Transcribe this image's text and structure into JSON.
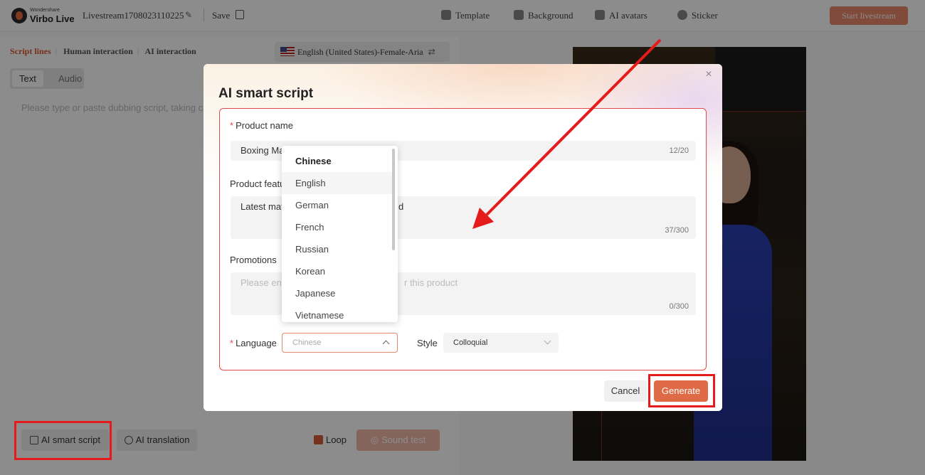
{
  "app": {
    "logo_small": "Wondershare",
    "logo_big": "Virbo Live",
    "project_name": "Livestream1708023110225",
    "save_label": "Save",
    "nav": [
      "Template",
      "Background",
      "AI avatars",
      "Sticker"
    ],
    "start_label": "Start livestream"
  },
  "left_panel": {
    "tabs": [
      "Script lines",
      "Human interaction",
      "AI interaction"
    ],
    "voice": "English (United States)-Female-Aria",
    "mode_tabs": [
      "Text",
      "Audio"
    ],
    "script_placeholder": "Please type or paste dubbing script, taking ca",
    "ai_smart_script": "AI smart script",
    "ai_translation": "AI translation",
    "loop": "Loop",
    "sound_test": "Sound test"
  },
  "modal": {
    "title": "AI smart script",
    "product_name_label": "Product name",
    "product_name_value": "Boxing Ma",
    "product_name_count": "12/20",
    "features_label": "Product featu",
    "features_value_left": "Latest mat",
    "features_value_right": "d",
    "features_count": "37/300",
    "promotions_label": "Promotions",
    "promotions_placeholder_left": "Please en",
    "promotions_placeholder_right": "r this product",
    "promotions_count": "0/300",
    "language_label": "Language",
    "language_value": "Chinese",
    "style_label": "Style",
    "style_value": "Colloquial",
    "cancel": "Cancel",
    "generate": "Generate"
  },
  "language_options": [
    "Chinese",
    "English",
    "German",
    "French",
    "Russian",
    "Korean",
    "Japanese",
    "Vietnamese"
  ],
  "colors": {
    "accent": "#df6a46",
    "highlight": "#e51b1b"
  }
}
